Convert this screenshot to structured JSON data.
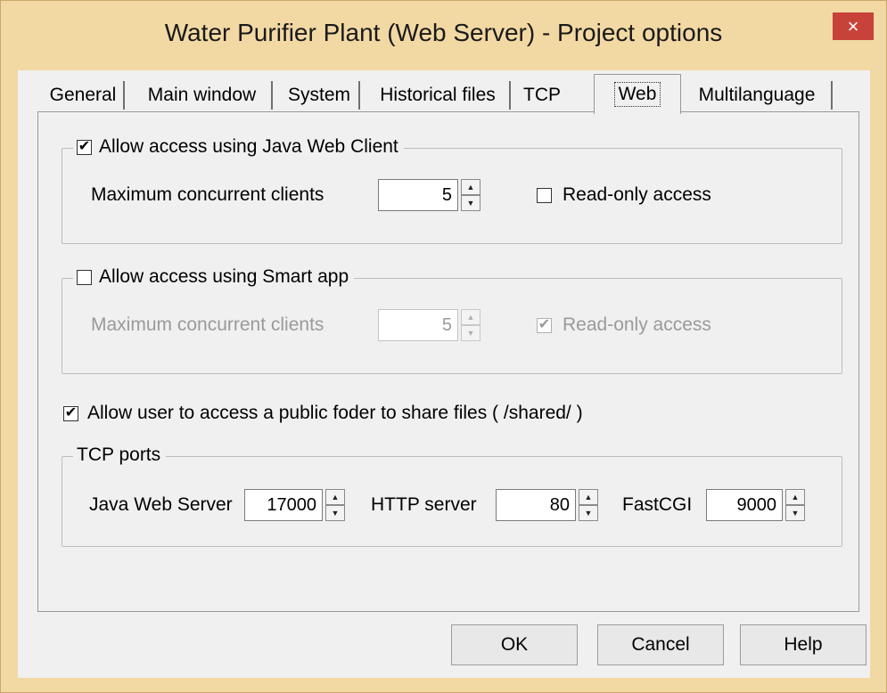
{
  "window": {
    "title": "Water Purifier Plant (Web Server) - Project options",
    "close_glyph": "×"
  },
  "tabs": [
    {
      "label": "General"
    },
    {
      "label": "Main window"
    },
    {
      "label": "System"
    },
    {
      "label": "Historical files"
    },
    {
      "label": "TCP"
    },
    {
      "label": "Web",
      "active": true
    },
    {
      "label": "Multilanguage"
    }
  ],
  "java_web_client": {
    "label": "Allow access using Java Web Client",
    "checked": true,
    "max_clients_label": "Maximum concurrent clients",
    "max_clients": "5",
    "read_only_label": "Read-only access",
    "read_only_checked": false
  },
  "smart_app": {
    "label": "Allow access using Smart app",
    "checked": false,
    "max_clients_label": "Maximum concurrent clients",
    "max_clients": "5",
    "read_only_label": "Read-only access",
    "read_only_checked": true,
    "disabled": true
  },
  "public_folder": {
    "label": "Allow user to access a public foder to share files ( /shared/ )",
    "checked": true
  },
  "tcp_ports": {
    "title": "TCP ports",
    "java_web_server_label": "Java Web Server",
    "java_web_server": "17000",
    "http_server_label": "HTTP server",
    "http_server": "80",
    "fastcgi_label": "FastCGI",
    "fastcgi": "9000"
  },
  "buttons": {
    "ok": "OK",
    "cancel": "Cancel",
    "help": "Help"
  },
  "glyphs": {
    "check": "✔",
    "spin_up": "▲",
    "spin_down": "▼"
  },
  "colors": {
    "title_bar": "#f2d9a4",
    "close_button": "#c7433a",
    "dialog_face": "#f0f0f0",
    "disabled_text": "#9a9a9a"
  }
}
